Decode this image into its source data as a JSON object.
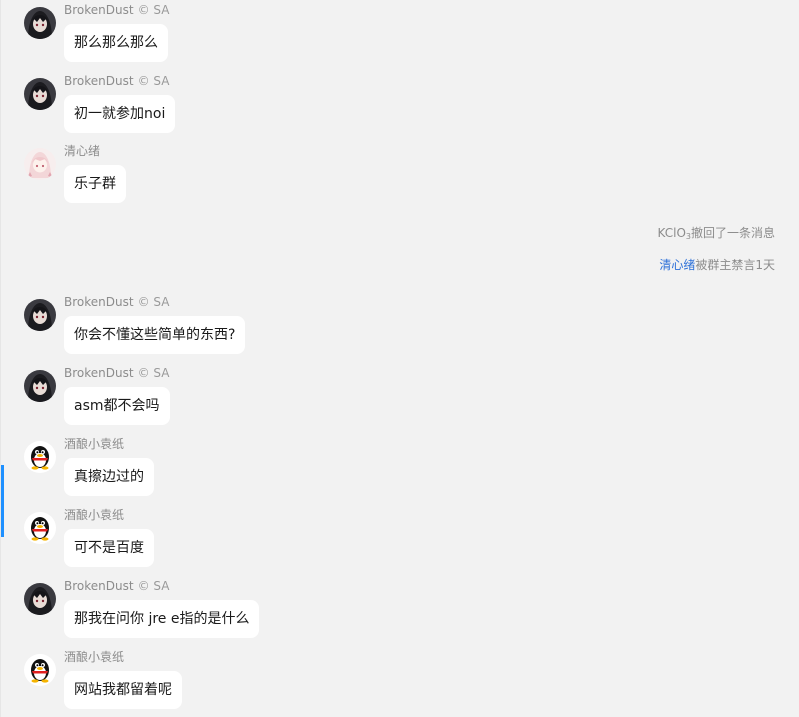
{
  "messages": [
    {
      "sender": "BrokenDust",
      "badge": "© SA",
      "text": "那么那么那么",
      "avatar": "anime-dark-avatar"
    },
    {
      "sender": "BrokenDust",
      "badge": "© SA",
      "text": "初一就参加noi",
      "avatar": "anime-dark-avatar"
    },
    {
      "sender": "清心绪",
      "badge": "",
      "text": "乐子群",
      "avatar": "anime-pink-avatar"
    },
    {
      "sender": "BrokenDust",
      "badge": "© SA",
      "text": "你会不懂这些简单的东西?",
      "avatar": "anime-dark-avatar"
    },
    {
      "sender": "BrokenDust",
      "badge": "© SA",
      "text": "asm都不会吗",
      "avatar": "anime-dark-avatar"
    },
    {
      "sender": "酒酿小袁纸",
      "badge": "",
      "text": "真擦边过的",
      "avatar": "penguin-avatar"
    },
    {
      "sender": "酒酿小袁纸",
      "badge": "",
      "text": "可不是百度",
      "avatar": "penguin-avatar"
    },
    {
      "sender": "BrokenDust",
      "badge": "© SA",
      "text": "那我在问你 jre e指的是什么",
      "avatar": "anime-dark-avatar"
    },
    {
      "sender": "酒酿小袁纸",
      "badge": "",
      "text": "网站我都留着呢",
      "avatar": "penguin-avatar"
    }
  ],
  "system": {
    "recall_actor_prefix": "KClO",
    "recall_actor_sub": "3",
    "recall_text": "撤回了一条消息",
    "mute_user": "清心绪",
    "mute_text": "被群主禁言1天"
  },
  "colors": {
    "background": "#f2f2f2",
    "bubble": "#ffffff",
    "link": "#2b6fd8",
    "scroll_indicator": "#1e90ff"
  }
}
